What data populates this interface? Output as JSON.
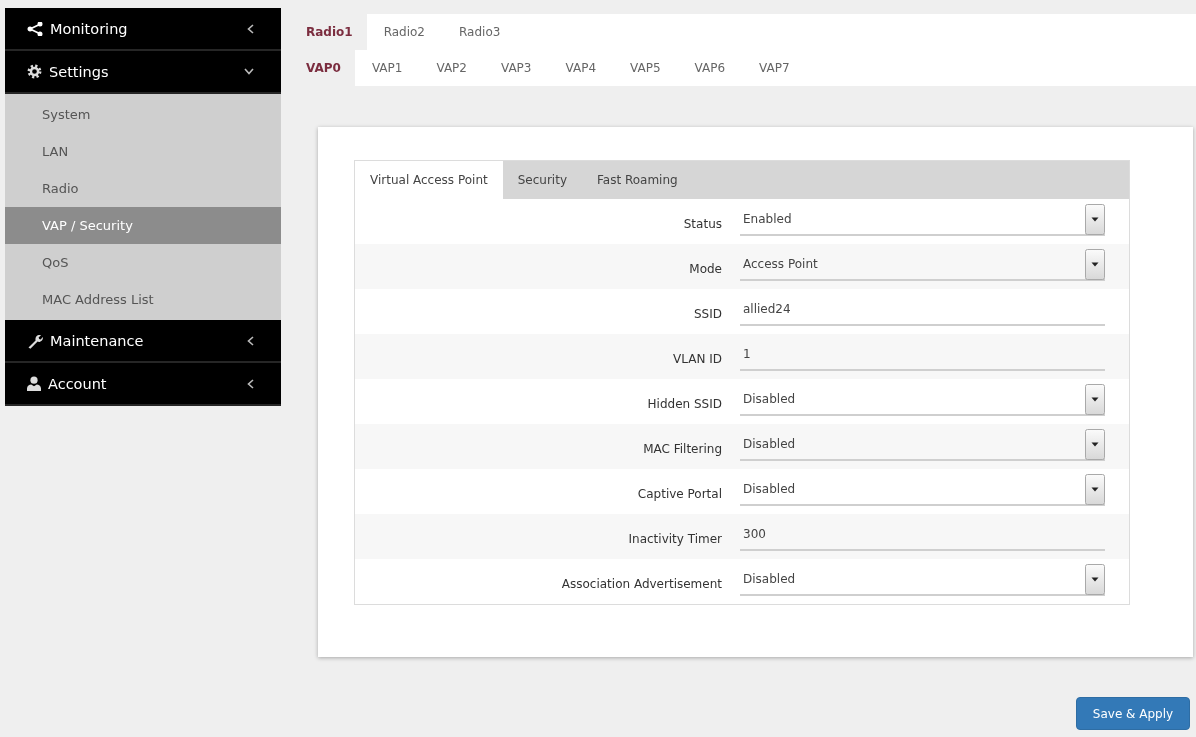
{
  "sidebar": {
    "items": [
      {
        "label": "Monitoring",
        "expanded": false
      },
      {
        "label": "Settings",
        "expanded": true,
        "children": [
          {
            "label": "System",
            "selected": false
          },
          {
            "label": "LAN",
            "selected": false
          },
          {
            "label": "Radio",
            "selected": false
          },
          {
            "label": "VAP / Security",
            "selected": true
          },
          {
            "label": "QoS",
            "selected": false
          },
          {
            "label": "MAC Address List",
            "selected": false
          }
        ]
      },
      {
        "label": "Maintenance",
        "expanded": false
      },
      {
        "label": "Account",
        "expanded": false
      }
    ]
  },
  "radio_tabs": [
    {
      "label": "Radio1",
      "selected": true
    },
    {
      "label": "Radio2",
      "selected": false
    },
    {
      "label": "Radio3",
      "selected": false
    }
  ],
  "vap_tabs": [
    {
      "label": "VAP0",
      "selected": true
    },
    {
      "label": "VAP1",
      "selected": false
    },
    {
      "label": "VAP2",
      "selected": false
    },
    {
      "label": "VAP3",
      "selected": false
    },
    {
      "label": "VAP4",
      "selected": false
    },
    {
      "label": "VAP5",
      "selected": false
    },
    {
      "label": "VAP6",
      "selected": false
    },
    {
      "label": "VAP7",
      "selected": false
    }
  ],
  "panel": {
    "tabs": [
      {
        "label": "Virtual Access Point",
        "selected": true
      },
      {
        "label": "Security",
        "selected": false
      },
      {
        "label": "Fast Roaming",
        "selected": false
      }
    ],
    "fields": [
      {
        "label": "Status",
        "kind": "select",
        "value": "Enabled"
      },
      {
        "label": "Mode",
        "kind": "select",
        "value": "Access Point"
      },
      {
        "label": "SSID",
        "kind": "text",
        "value": "allied24"
      },
      {
        "label": "VLAN ID",
        "kind": "text",
        "value": "1"
      },
      {
        "label": "Hidden SSID",
        "kind": "select",
        "value": "Disabled"
      },
      {
        "label": "MAC Filtering",
        "kind": "select",
        "value": "Disabled"
      },
      {
        "label": "Captive Portal",
        "kind": "select",
        "value": "Disabled"
      },
      {
        "label": "Inactivity Timer",
        "kind": "text",
        "value": "300"
      },
      {
        "label": "Association Advertisement",
        "kind": "select",
        "value": "Disabled"
      }
    ]
  },
  "save_button": {
    "label": "Save & Apply"
  }
}
